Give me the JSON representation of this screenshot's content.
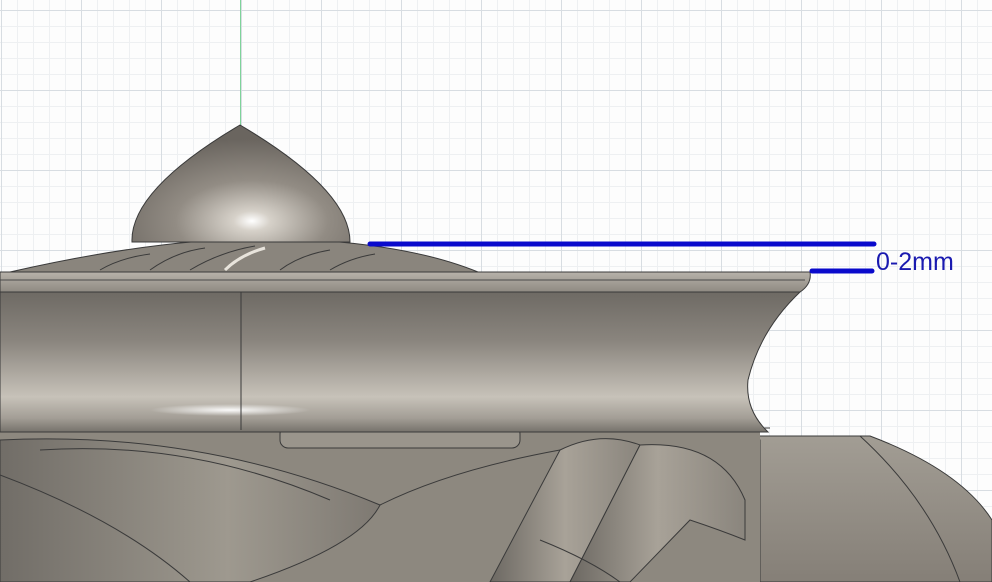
{
  "annotation": {
    "label": "0-2mm",
    "color": "#0a0acc"
  },
  "viewport": {
    "grid_color": "#d8dde2",
    "model_color": "#8c857c",
    "axis_color": "#7fd39a"
  }
}
